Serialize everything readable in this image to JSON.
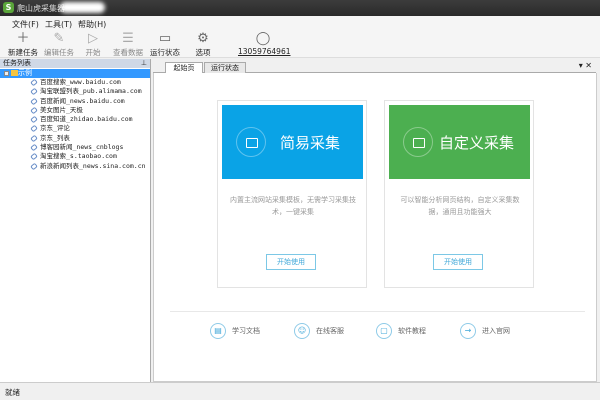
{
  "window": {
    "title": "爬山虎采集器"
  },
  "menu": [
    "文件(F)",
    "工具(T)",
    "帮助(H)"
  ],
  "toolbar": [
    {
      "label": "新建任务",
      "icon": "plus-icon",
      "enabled": true
    },
    {
      "label": "编辑任务",
      "icon": "edit-icon",
      "enabled": false
    },
    {
      "label": "开始",
      "icon": "play-icon",
      "enabled": false
    },
    {
      "label": "查看数据",
      "icon": "database-icon",
      "enabled": false
    },
    {
      "label": "运行状态",
      "icon": "monitor-icon",
      "enabled": true
    },
    {
      "label": "选项",
      "icon": "gear-icon",
      "enabled": true
    }
  ],
  "account": "13059764961",
  "left_panel": {
    "title": "任务列表",
    "root": "示例",
    "items": [
      "百度搜索_www.baidu.com",
      "淘宝联盟列表_pub.alimama.com",
      "百度新闻_news.baidu.com",
      "美女图片_天极",
      "百度知道_zhidao.baidu.com",
      "京东_评论",
      "京东_列表",
      "博客园新闻_news_cnblogs",
      "淘宝搜索_s.taobao.com",
      "新浪新闻列表_news.sina.com.cn"
    ]
  },
  "tabs": [
    "起始页",
    "运行状态"
  ],
  "cards": [
    {
      "title": "简易采集",
      "desc": "内置主流网站采集模板，无需学习采集技术，一键采集",
      "button": "开始使用",
      "color": "#0aa3e6"
    },
    {
      "title": "自定义采集",
      "desc": "可以智能分析网页结构，自定义采集数据，通用且功能强大",
      "button": "开始使用",
      "color": "#4caf50"
    }
  ],
  "links": [
    {
      "label": "学习文档",
      "icon": "document-icon"
    },
    {
      "label": "在线客服",
      "icon": "person-icon"
    },
    {
      "label": "软件教程",
      "icon": "book-icon"
    },
    {
      "label": "进入官网",
      "icon": "arrow-right-icon"
    }
  ],
  "status": "就绪"
}
